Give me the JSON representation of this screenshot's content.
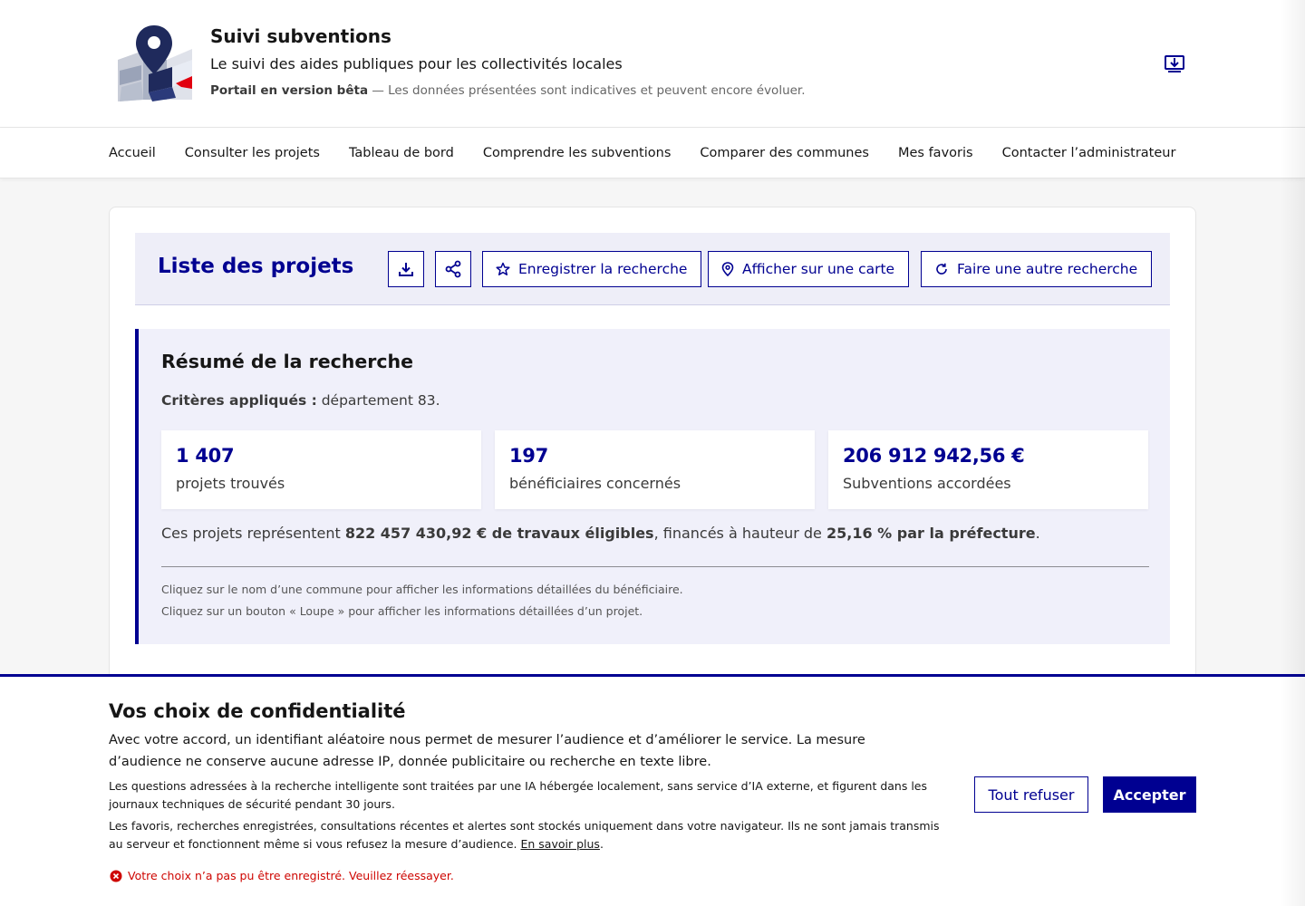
{
  "header": {
    "title": "Suivi subventions",
    "tagline": "Le suivi des aides publiques pour les collectivités locales",
    "beta_label": "Portail en version bêta",
    "beta_text": " — Les données présentées sont indicatives et peuvent encore évoluer.",
    "install_icon": "download-app-icon"
  },
  "nav": {
    "items": [
      {
        "label": "Accueil"
      },
      {
        "label": "Consulter les projets"
      },
      {
        "label": "Tableau de bord"
      },
      {
        "label": "Comprendre les subventions"
      },
      {
        "label": "Comparer des communes"
      },
      {
        "label": "Mes favoris"
      },
      {
        "label": "Contacter l’administrateur"
      }
    ]
  },
  "list": {
    "title": "Liste des projets",
    "buttons": {
      "download_icon": "download-icon",
      "share_icon": "share-icon",
      "save_search": "Enregistrer la recherche",
      "show_map": "Afficher sur une carte",
      "new_search": "Faire une autre recherche"
    }
  },
  "summary": {
    "title": "Résumé de la recherche",
    "criteria_label": "Critères appliqués :",
    "criteria_value": " département 83.",
    "stats": [
      {
        "value": "1 407",
        "label": "projets trouvés"
      },
      {
        "value": "197",
        "label": "bénéficiaires concernés"
      },
      {
        "value": "206 912 942,56 €",
        "label": "Subventions accordées"
      }
    ],
    "line": {
      "prefix": "Ces projets représentent ",
      "amount": "822 457 430,92 € de travaux éligibles",
      "middle": ", financés à hauteur de ",
      "rate": "25,16 % par la préfecture",
      "suffix": "."
    },
    "hints": [
      "Cliquez sur le nom d’une commune pour afficher les informations détaillées du bénéficiaire.",
      "Cliquez sur un bouton « Loupe » pour afficher les informations détaillées d’un projet."
    ]
  },
  "consent": {
    "title": "Vos choix de confidentialité",
    "main": "Avec votre accord, un identifiant aléatoire nous permet de mesurer l’audience et d’améliorer le service. La mesure d’audience ne conserve aucune adresse IP, donnée publicitaire ou recherche en texte libre.",
    "ai_note": "Les questions adressées à la recherche intelligente sont traitées par une IA hébergée localement, sans service d’IA externe, et figurent dans les journaux techniques de sécurité pendant 30 jours.",
    "storage_note": "Les favoris, recherches enregistrées, consultations récentes et alertes sont stockés uniquement dans votre navigateur. Ils ne sont jamais transmis au serveur et fonctionnent même si vous refusez la mesure d’audience. ",
    "learn_more": "En savoir plus",
    "learn_more_suffix": ".",
    "refuse": "Tout refuser",
    "accept": "Accepter",
    "error": "Votre choix n’a pas pu être enregistré. Veuillez réessayer."
  },
  "colors": {
    "primary": "#000091",
    "error": "#ce0500",
    "summary_bg": "#f0f0fa"
  }
}
